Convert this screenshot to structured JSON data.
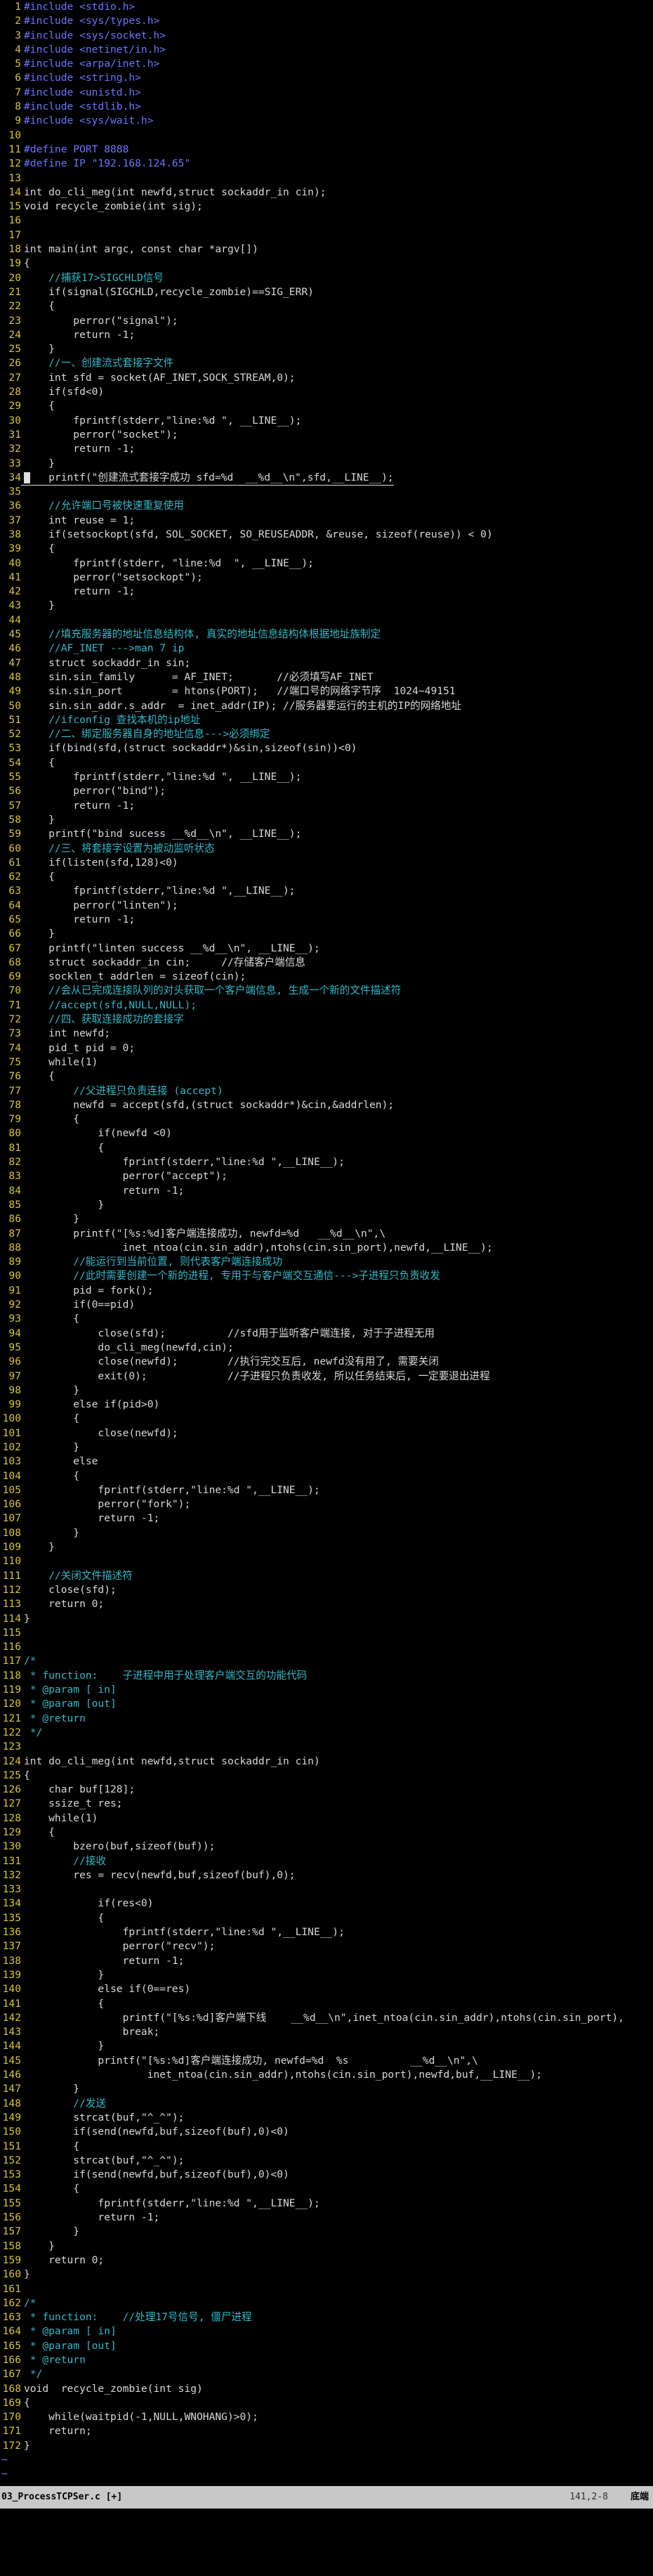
{
  "editor": {
    "lines": [
      {
        "n": "1",
        "t": "#include <stdio.h>",
        "c": "pp"
      },
      {
        "n": "2",
        "t": "#include <sys/types.h>",
        "c": "pp"
      },
      {
        "n": "3",
        "t": "#include <sys/socket.h>",
        "c": "pp"
      },
      {
        "n": "4",
        "t": "#include <netinet/in.h>",
        "c": "pp"
      },
      {
        "n": "5",
        "t": "#include <arpa/inet.h>",
        "c": "pp"
      },
      {
        "n": "6",
        "t": "#include <string.h>",
        "c": "pp"
      },
      {
        "n": "7",
        "t": "#include <unistd.h>",
        "c": "pp"
      },
      {
        "n": "8",
        "t": "#include <stdlib.h>",
        "c": "pp"
      },
      {
        "n": "9",
        "t": "#include <sys/wait.h>",
        "c": "pp"
      },
      {
        "n": "10",
        "t": "",
        "c": ""
      },
      {
        "n": "11",
        "t": "#define PORT 8888",
        "c": "pp"
      },
      {
        "n": "12",
        "t": "#define IP \"192.168.124.65\"",
        "c": "pp"
      },
      {
        "n": "13",
        "t": "",
        "c": ""
      },
      {
        "n": "14",
        "t": "int do_cli_meg(int newfd,struct sockaddr_in cin);",
        "c": ""
      },
      {
        "n": "15",
        "t": "void recycle_zombie(int sig);",
        "c": ""
      },
      {
        "n": "16",
        "t": "",
        "c": ""
      },
      {
        "n": "17",
        "t": "",
        "c": ""
      },
      {
        "n": "18",
        "t": "int main(int argc, const char *argv[])",
        "c": ""
      },
      {
        "n": "19",
        "t": "{",
        "c": ""
      },
      {
        "n": "20",
        "t": "    //捕获17>SIGCHLD信号",
        "c": "cm"
      },
      {
        "n": "21",
        "t": "    if(signal(SIGCHLD,recycle_zombie)==SIG_ERR)",
        "c": ""
      },
      {
        "n": "22",
        "t": "    {",
        "c": ""
      },
      {
        "n": "23",
        "t": "        perror(\"signal\");",
        "c": ""
      },
      {
        "n": "24",
        "t": "        return -1;",
        "c": ""
      },
      {
        "n": "25",
        "t": "    }",
        "c": ""
      },
      {
        "n": "26",
        "t": "    //一、创建流式套接字文件",
        "c": "cm"
      },
      {
        "n": "27",
        "t": "    int sfd = socket(AF_INET,SOCK_STREAM,0);",
        "c": ""
      },
      {
        "n": "28",
        "t": "    if(sfd<0)",
        "c": ""
      },
      {
        "n": "29",
        "t": "    {",
        "c": ""
      },
      {
        "n": "30",
        "t": "        fprintf(stderr,\"line:%d \", __LINE__);",
        "c": ""
      },
      {
        "n": "31",
        "t": "        perror(\"socket\");",
        "c": ""
      },
      {
        "n": "32",
        "t": "        return -1;",
        "c": ""
      },
      {
        "n": "33",
        "t": "    }",
        "c": ""
      },
      {
        "n": "34",
        "t": "    printf(\"创建流式套接字成功 sfd=%d  __%d__\\n\",sfd,__LINE__);",
        "c": "cl"
      },
      {
        "n": "35",
        "t": "",
        "c": ""
      },
      {
        "n": "36",
        "t": "    //允许端口号被快速重复使用",
        "c": "cm"
      },
      {
        "n": "37",
        "t": "    int reuse = 1;",
        "c": ""
      },
      {
        "n": "38",
        "t": "    if(setsockopt(sfd, SOL_SOCKET, SO_REUSEADDR, &reuse, sizeof(reuse)) < 0)",
        "c": ""
      },
      {
        "n": "39",
        "t": "    {",
        "c": ""
      },
      {
        "n": "40",
        "t": "        fprintf(stderr, \"line:%d  \", __LINE__);",
        "c": ""
      },
      {
        "n": "41",
        "t": "        perror(\"setsockopt\");",
        "c": ""
      },
      {
        "n": "42",
        "t": "        return -1;",
        "c": ""
      },
      {
        "n": "43",
        "t": "    }",
        "c": ""
      },
      {
        "n": "44",
        "t": "",
        "c": ""
      },
      {
        "n": "45",
        "t": "    //填充服务器的地址信息结构体, 真实的地址信息结构体根据地址族制定",
        "c": "cm"
      },
      {
        "n": "46",
        "t": "    //AF_INET --->man 7 ip",
        "c": "cm"
      },
      {
        "n": "47",
        "t": "    struct sockaddr_in sin;",
        "c": ""
      },
      {
        "n": "48",
        "t": "    sin.sin_family      = AF_INET;       //必须填写AF_INET",
        "c": ""
      },
      {
        "n": "49",
        "t": "    sin.sin_port        = htons(PORT);   //端口号的网络字节序  1024~49151",
        "c": ""
      },
      {
        "n": "50",
        "t": "    sin.sin_addr.s_addr  = inet_addr(IP); //服务器要运行的主机的IP的网络地址",
        "c": ""
      },
      {
        "n": "51",
        "t": "    //ifconfig 查找本机的ip地址",
        "c": "cm"
      },
      {
        "n": "52",
        "t": "    //二、绑定服务器自身的地址信息--->必须绑定",
        "c": "cm"
      },
      {
        "n": "53",
        "t": "    if(bind(sfd,(struct sockaddr*)&sin,sizeof(sin))<0)",
        "c": ""
      },
      {
        "n": "54",
        "t": "    {",
        "c": ""
      },
      {
        "n": "55",
        "t": "        fprintf(stderr,\"line:%d \", __LINE__);",
        "c": ""
      },
      {
        "n": "56",
        "t": "        perror(\"bind\");",
        "c": ""
      },
      {
        "n": "57",
        "t": "        return -1;",
        "c": ""
      },
      {
        "n": "58",
        "t": "    }",
        "c": ""
      },
      {
        "n": "59",
        "t": "    printf(\"bind sucess __%d__\\n\", __LINE__);",
        "c": ""
      },
      {
        "n": "60",
        "t": "    //三、将套接字设置为被动监听状态",
        "c": "cm"
      },
      {
        "n": "61",
        "t": "    if(listen(sfd,128)<0)",
        "c": ""
      },
      {
        "n": "62",
        "t": "    {",
        "c": ""
      },
      {
        "n": "63",
        "t": "        fprintf(stderr,\"line:%d \",__LINE__);",
        "c": ""
      },
      {
        "n": "64",
        "t": "        perror(\"linten\");",
        "c": ""
      },
      {
        "n": "65",
        "t": "        return -1;",
        "c": ""
      },
      {
        "n": "66",
        "t": "    }",
        "c": ""
      },
      {
        "n": "67",
        "t": "    printf(\"linten success __%d__\\n\", __LINE__);",
        "c": ""
      },
      {
        "n": "68",
        "t": "    struct sockaddr_in cin;     //存储客户端信息",
        "c": ""
      },
      {
        "n": "69",
        "t": "    socklen_t addrlen = sizeof(cin);",
        "c": ""
      },
      {
        "n": "70",
        "t": "    //会从已完成连接队列的对头获取一个客户端信息, 生成一个新的文件描述符",
        "c": "cm"
      },
      {
        "n": "71",
        "t": "    //accept(sfd,NULL,NULL);",
        "c": "cm"
      },
      {
        "n": "72",
        "t": "    //四、获取连接成功的套接字",
        "c": "cm"
      },
      {
        "n": "73",
        "t": "    int newfd;",
        "c": ""
      },
      {
        "n": "74",
        "t": "    pid_t pid = 0;",
        "c": ""
      },
      {
        "n": "75",
        "t": "    while(1)",
        "c": ""
      },
      {
        "n": "76",
        "t": "    {",
        "c": ""
      },
      {
        "n": "77",
        "t": "        //父进程只负责连接 (accept)",
        "c": "cm"
      },
      {
        "n": "78",
        "t": "        newfd = accept(sfd,(struct sockaddr*)&cin,&addrlen);",
        "c": ""
      },
      {
        "n": "79",
        "t": "        {",
        "c": ""
      },
      {
        "n": "80",
        "t": "            if(newfd <0)",
        "c": ""
      },
      {
        "n": "81",
        "t": "            {",
        "c": ""
      },
      {
        "n": "82",
        "t": "                fprintf(stderr,\"line:%d \",__LINE__);",
        "c": ""
      },
      {
        "n": "83",
        "t": "                perror(\"accept\");",
        "c": ""
      },
      {
        "n": "84",
        "t": "                return -1;",
        "c": ""
      },
      {
        "n": "85",
        "t": "            }",
        "c": ""
      },
      {
        "n": "86",
        "t": "        }",
        "c": ""
      },
      {
        "n": "87",
        "t": "        printf(\"[%s:%d]客户端连接成功, newfd=%d   __%d__\\n\",\\",
        "c": ""
      },
      {
        "n": "88",
        "t": "                inet_ntoa(cin.sin_addr),ntohs(cin.sin_port),newfd,__LINE__);",
        "c": ""
      },
      {
        "n": "89",
        "t": "        //能运行到当前位置, 则代表客户端连接成功",
        "c": "cm"
      },
      {
        "n": "90",
        "t": "        //此时需要创建一个新的进程, 专用于与客户端交互通信--->子进程只负责收发",
        "c": "cm"
      },
      {
        "n": "91",
        "t": "        pid = fork();",
        "c": ""
      },
      {
        "n": "92",
        "t": "        if(0==pid)",
        "c": ""
      },
      {
        "n": "93",
        "t": "        {",
        "c": ""
      },
      {
        "n": "94",
        "t": "            close(sfd);          //sfd用于监听客户端连接, 对于子进程无用",
        "c": ""
      },
      {
        "n": "95",
        "t": "            do_cli_meg(newfd,cin);",
        "c": ""
      },
      {
        "n": "96",
        "t": "            close(newfd);        //执行完交互后, newfd没有用了, 需要关闭",
        "c": ""
      },
      {
        "n": "97",
        "t": "            exit(0);             //子进程只负责收发, 所以任务结束后, 一定要退出进程",
        "c": ""
      },
      {
        "n": "98",
        "t": "        }",
        "c": ""
      },
      {
        "n": "99",
        "t": "        else if(pid>0)",
        "c": ""
      },
      {
        "n": "100",
        "t": "        {",
        "c": ""
      },
      {
        "n": "101",
        "t": "            close(newfd);",
        "c": ""
      },
      {
        "n": "102",
        "t": "        }",
        "c": ""
      },
      {
        "n": "103",
        "t": "        else",
        "c": ""
      },
      {
        "n": "104",
        "t": "        {",
        "c": ""
      },
      {
        "n": "105",
        "t": "            fprintf(stderr,\"line:%d \",__LINE__);",
        "c": ""
      },
      {
        "n": "106",
        "t": "            perror(\"fork\");",
        "c": ""
      },
      {
        "n": "107",
        "t": "            return -1;",
        "c": ""
      },
      {
        "n": "108",
        "t": "        }",
        "c": ""
      },
      {
        "n": "109",
        "t": "    }",
        "c": ""
      },
      {
        "n": "110",
        "t": "",
        "c": ""
      },
      {
        "n": "111",
        "t": "    //关闭文件描述符",
        "c": "cm"
      },
      {
        "n": "112",
        "t": "    close(sfd);",
        "c": ""
      },
      {
        "n": "113",
        "t": "    return 0;",
        "c": ""
      },
      {
        "n": "114",
        "t": "}",
        "c": ""
      },
      {
        "n": "115",
        "t": "",
        "c": ""
      },
      {
        "n": "116",
        "t": "",
        "c": ""
      },
      {
        "n": "117",
        "t": "/*",
        "c": "cm"
      },
      {
        "n": "118",
        "t": " * function:    子进程中用于处理客户端交互的功能代码",
        "c": "cm"
      },
      {
        "n": "119",
        "t": " * @param [ in]",
        "c": "cm"
      },
      {
        "n": "120",
        "t": " * @param [out]",
        "c": "cm"
      },
      {
        "n": "121",
        "t": " * @return",
        "c": "cm"
      },
      {
        "n": "122",
        "t": " */",
        "c": "cm"
      },
      {
        "n": "123",
        "t": "",
        "c": ""
      },
      {
        "n": "124",
        "t": "int do_cli_meg(int newfd,struct sockaddr_in cin)",
        "c": ""
      },
      {
        "n": "125",
        "t": "{",
        "c": ""
      },
      {
        "n": "126",
        "t": "    char buf[128];",
        "c": ""
      },
      {
        "n": "127",
        "t": "    ssize_t res;",
        "c": ""
      },
      {
        "n": "128",
        "t": "    while(1)",
        "c": ""
      },
      {
        "n": "129",
        "t": "    {",
        "c": ""
      },
      {
        "n": "130",
        "t": "        bzero(buf,sizeof(buf));",
        "c": ""
      },
      {
        "n": "131",
        "t": "        //接收",
        "c": "cm"
      },
      {
        "n": "132",
        "t": "        res = recv(newfd,buf,sizeof(buf),0);",
        "c": ""
      },
      {
        "n": "133",
        "t": "",
        "c": ""
      },
      {
        "n": "134",
        "t": "            if(res<0)",
        "c": ""
      },
      {
        "n": "135",
        "t": "            {",
        "c": ""
      },
      {
        "n": "136",
        "t": "                fprintf(stderr,\"line:%d \",__LINE__);",
        "c": ""
      },
      {
        "n": "137",
        "t": "                perror(\"recv\");",
        "c": ""
      },
      {
        "n": "138",
        "t": "                return -1;",
        "c": ""
      },
      {
        "n": "139",
        "t": "            }",
        "c": ""
      },
      {
        "n": "140",
        "t": "            else if(0==res)",
        "c": ""
      },
      {
        "n": "141",
        "t": "            {",
        "c": ""
      },
      {
        "n": "142",
        "t": "                printf(\"[%s:%d]客户端下线    __%d__\\n\",inet_ntoa(cin.sin_addr),ntohs(cin.sin_port),",
        "c": ""
      },
      {
        "n": "143",
        "t": "                break;",
        "c": ""
      },
      {
        "n": "144",
        "t": "            }",
        "c": ""
      },
      {
        "n": "145",
        "t": "            printf(\"[%s:%d]客户端连接成功, newfd=%d  %s          __%d__\\n\",\\",
        "c": ""
      },
      {
        "n": "146",
        "t": "                    inet_ntoa(cin.sin_addr),ntohs(cin.sin_port),newfd,buf,__LINE__);",
        "c": ""
      },
      {
        "n": "147",
        "t": "        }",
        "c": ""
      },
      {
        "n": "148",
        "t": "        //发送",
        "c": "cm"
      },
      {
        "n": "149",
        "t": "        strcat(buf,\"^_^\");",
        "c": ""
      },
      {
        "n": "150",
        "t": "        if(send(newfd,buf,sizeof(buf),0)<0)",
        "c": ""
      },
      {
        "n": "151",
        "t": "        {",
        "c": ""
      },
      {
        "n": "152",
        "t": "        strcat(buf,\"^_^\");",
        "c": ""
      },
      {
        "n": "153",
        "t": "        if(send(newfd,buf,sizeof(buf),0)<0)",
        "c": ""
      },
      {
        "n": "154",
        "t": "        {",
        "c": ""
      },
      {
        "n": "155",
        "t": "            fprintf(stderr,\"line:%d \",__LINE__);",
        "c": ""
      },
      {
        "n": "156",
        "t": "            return -1;",
        "c": ""
      },
      {
        "n": "157",
        "t": "        }",
        "c": ""
      },
      {
        "n": "158",
        "t": "    }",
        "c": ""
      },
      {
        "n": "159",
        "t": "    return 0;",
        "c": ""
      },
      {
        "n": "160",
        "t": "}",
        "c": ""
      },
      {
        "n": "161",
        "t": "",
        "c": ""
      },
      {
        "n": "162",
        "t": "/*",
        "c": "cm"
      },
      {
        "n": "163",
        "t": " * function:    //处理17号信号, 僵尸进程",
        "c": "cm"
      },
      {
        "n": "164",
        "t": " * @param [ in]",
        "c": "cm"
      },
      {
        "n": "165",
        "t": " * @param [out]",
        "c": "cm"
      },
      {
        "n": "166",
        "t": " * @return",
        "c": "cm"
      },
      {
        "n": "167",
        "t": " */",
        "c": "cm"
      },
      {
        "n": "168",
        "t": "void  recycle_zombie(int sig)",
        "c": ""
      },
      {
        "n": "169",
        "t": "{",
        "c": ""
      },
      {
        "n": "170",
        "t": "    while(waitpid(-1,NULL,WNOHANG)>0);",
        "c": ""
      },
      {
        "n": "171",
        "t": "    return;",
        "c": ""
      },
      {
        "n": "172",
        "t": "}",
        "c": ""
      }
    ],
    "filler_glyph": "~",
    "filler_count": 4
  },
  "status_bar": {
    "filename": "03_ProcessTCPSer.c [+]",
    "position": "141,2-8",
    "percent": "底端"
  },
  "colors": {
    "background": "#000000",
    "line_number": "#d6c43a",
    "comment": "#33b8c8",
    "preprocessor": "#6a74ff",
    "status_bar": "#c8c8c8"
  }
}
